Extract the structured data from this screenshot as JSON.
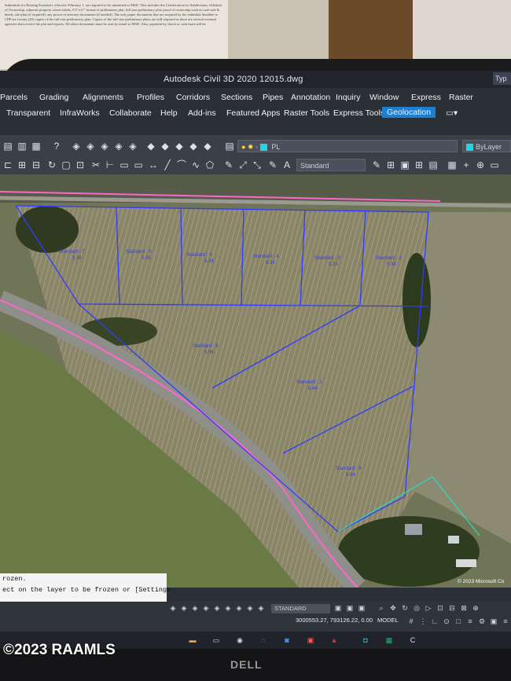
{
  "paper": {
    "text": "Submittals for Hearing Examiner, effective February 1, are required to be submitted to MSD. This includes the Certification for Subdivision, Affidavit of Ownership, adjacent property owner labels, 8.5\"x11\" format of preliminary plat, full size preliminary plat, proof of ownership such as cash sale & deeds, site plan (if required), any power of attorney documents (if needed). The only paper documents that are required by the submittal deadline to CPF are twenty (20) copies of the full size preliminary plan. Copies of the full size preliminary plans are still required as there are several external agencies that receive the plat and reports. All other documents must be sent by email to MSD. Also, payment by check or cash must still be"
  },
  "app": {
    "title": "Autodesk Civil 3D 2020   12015.dwg",
    "type_box": "Typ"
  },
  "menu_row1": [
    "Parcels",
    "Grading",
    "Alignments",
    "Profiles",
    "Corridors",
    "Sections",
    "Pipes",
    "Annotation",
    "Inquiry",
    "Window",
    "Express",
    "Raster"
  ],
  "menu_row2": [
    "Transparent",
    "InfraWorks",
    "Collaborate",
    "Help",
    "Add-ins",
    "Featured Apps",
    "Raster Tools",
    "Express Tools",
    "Geolocation"
  ],
  "menu_active": "Geolocation",
  "toolbar": {
    "layer_name": "PL",
    "bylayer": "ByLayer",
    "text_style": "Standard"
  },
  "parcels": [
    {
      "name": "Standard : 7",
      "area": "5.36"
    },
    {
      "name": "Standard : 6",
      "area": "5.26"
    },
    {
      "name": "Standard : 5",
      "area": "5.34"
    },
    {
      "name": "Standard : 4",
      "area": "5.34"
    },
    {
      "name": "Standard : 3",
      "area": "5.33"
    },
    {
      "name": "Standard : 2",
      "area": "5.34"
    },
    {
      "name": "Standard : 8",
      "area": "5.56"
    },
    {
      "name": "Standard : 1",
      "area": "5.44"
    },
    {
      "name": "Standard : 9",
      "area": "5.64"
    }
  ],
  "command_line": {
    "line1": "rozen.",
    "line2": "ect on the layer to be frozen or [Settings"
  },
  "status": {
    "style": "STANDARD",
    "coordinates": "3000553.27, 793126.22, 0.00",
    "space": "MODEL",
    "map_credit": "© 2023 Microsoft Co"
  },
  "monitor_brand": "DELL",
  "watermark": "©2023 RAAMLS",
  "colors": {
    "parcel_lines": "#2f3cff",
    "road_line": "#ff66cc",
    "property_line": "#2fd8b5",
    "active_menu": "#1d7fd1"
  }
}
